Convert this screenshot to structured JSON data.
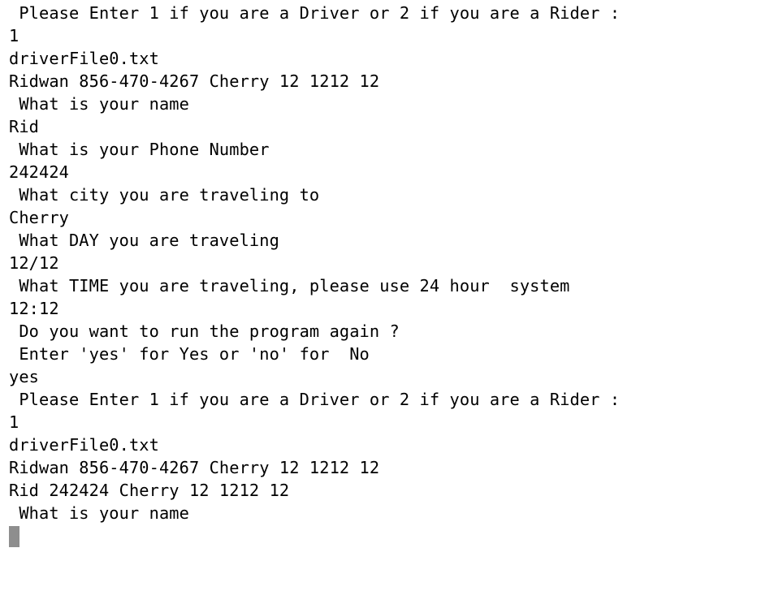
{
  "terminal": {
    "lines": [
      " Please Enter 1 if you are a Driver or 2 if you are a Rider :",
      "1",
      "driverFile0.txt",
      "Ridwan 856-470-4267 Cherry 12 1212 12",
      " What is your name",
      "Rid",
      " What is your Phone Number",
      "242424",
      " What city you are traveling to",
      "Cherry",
      " What DAY you are traveling",
      "12/12",
      " What TIME you are traveling, please use 24 hour  system",
      "12:12",
      " Do you want to run the program again ?",
      " Enter 'yes' for Yes or 'no' for  No",
      "yes",
      " Please Enter 1 if you are a Driver or 2 if you are a Rider :",
      "1",
      "driverFile0.txt",
      "Ridwan 856-470-4267 Cherry 12 1212 12",
      "Rid 242424 Cherry 12 1212 12",
      " What is your name"
    ],
    "cursor_color": "#8e8e8e"
  }
}
